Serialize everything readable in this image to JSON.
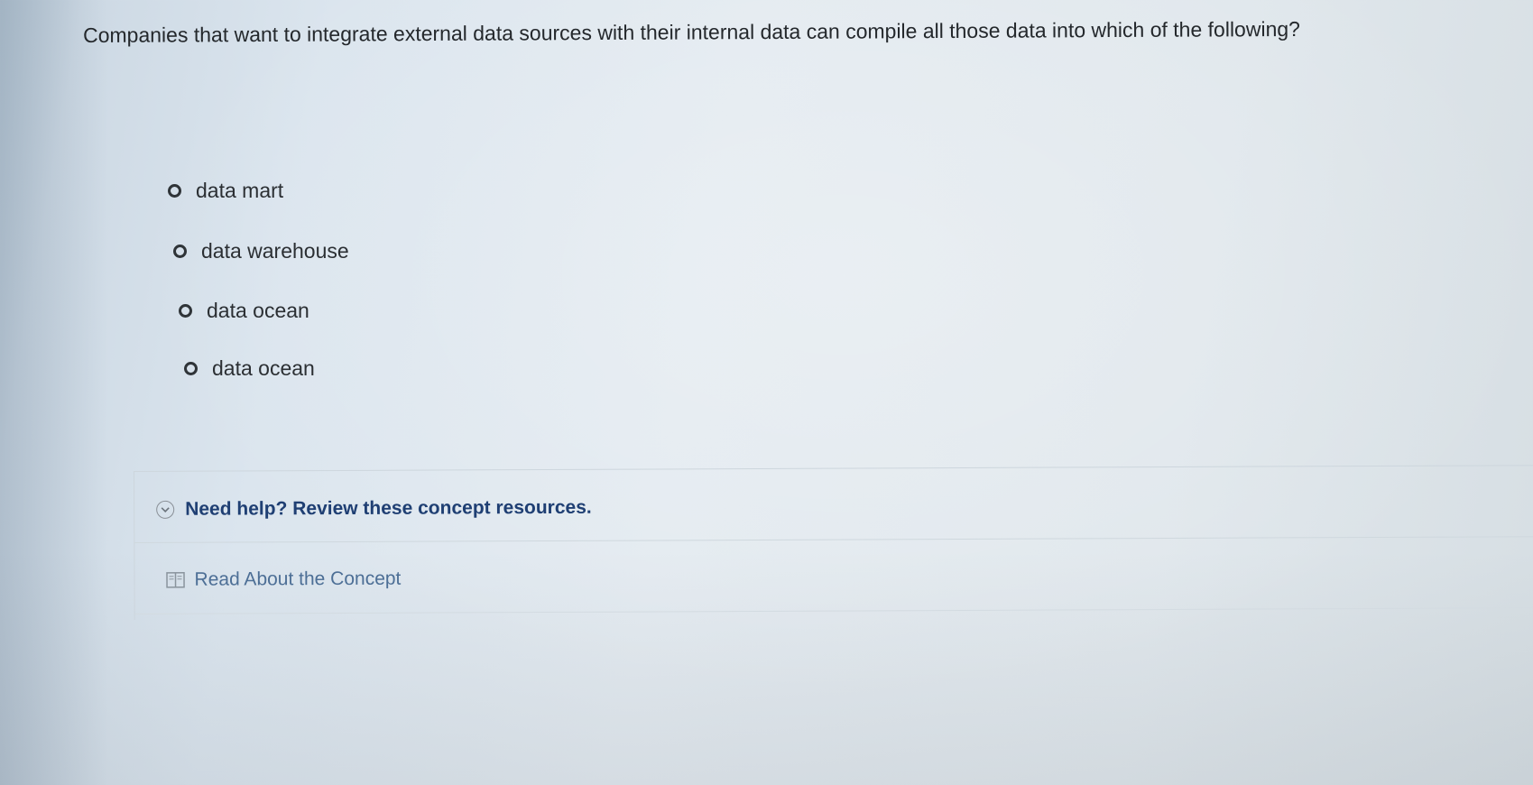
{
  "question": {
    "text": "Companies that want to integrate external data sources with their internal data can compile all those data into which of the following?"
  },
  "choices": [
    {
      "label": "data mart",
      "selected": false
    },
    {
      "label": "data warehouse",
      "selected": false
    },
    {
      "label": "data ocean",
      "selected": false
    },
    {
      "label": "data ocean",
      "selected": false
    }
  ],
  "help": {
    "toggle_label": "Need help? Review these concept resources.",
    "toggle_icon": "chevron-down-circle-icon",
    "resource_label": "Read About the Concept",
    "resource_icon": "book-icon"
  },
  "colors": {
    "help_text": "#1f3f73",
    "link_text": "#4d6f96",
    "body_text": "#2b2f33"
  }
}
